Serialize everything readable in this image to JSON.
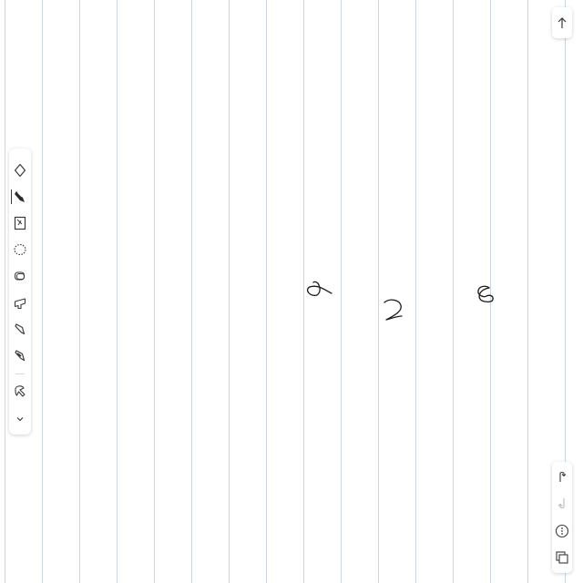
{
  "app": {
    "page_background": "#ffffff",
    "rule_color": "#c9d6e4",
    "ink_color": "#1a1a1a",
    "icon_color": "#3a3a3a"
  },
  "handwriting": [
    "6",
    "2",
    "8"
  ],
  "toolbar": {
    "tools": [
      {
        "name": "eraser-icon",
        "active": false
      },
      {
        "name": "pen-icon",
        "active": true
      },
      {
        "name": "page-template-icon",
        "active": false
      },
      {
        "name": "lasso-select-icon",
        "active": false
      },
      {
        "name": "shape-icon",
        "active": false
      },
      {
        "name": "tape-icon",
        "active": false
      },
      {
        "name": "highlighter-icon",
        "active": false
      },
      {
        "name": "marker-icon",
        "active": false
      },
      {
        "name": "laser-pointer-icon",
        "active": false
      },
      {
        "name": "chevron-down-icon",
        "active": false
      }
    ]
  },
  "right_controls": {
    "top": [
      "arrow-up-icon"
    ],
    "bottom": [
      "undo-icon",
      "redo-icon",
      "more-options-icon",
      "pages-icon"
    ]
  }
}
